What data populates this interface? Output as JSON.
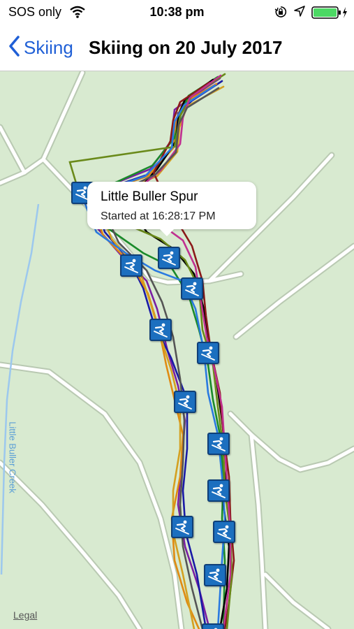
{
  "status_bar": {
    "carrier": "SOS only",
    "time": "10:38 pm",
    "icons": [
      "wifi-icon",
      "orientation-lock-icon",
      "location-arrow-icon",
      "battery-charging-icon"
    ],
    "battery_color": "#4cd964"
  },
  "nav": {
    "back_label": "Skiing",
    "title": "Skiing on 20 July 2017",
    "accent_color": "#1f5fd6"
  },
  "map": {
    "callout": {
      "title": "Little Buller Spur",
      "subtitle": "Started at 16:28:17 PM"
    },
    "creek_label": "Little Buller Creek",
    "legal_label": "Legal",
    "marker_icon": "skier-icon",
    "marker_color": "#1c6fbf",
    "track_colors": [
      "#7a1fa2",
      "#1a1aa6",
      "#e08a12",
      "#1a8a2a",
      "#000000",
      "#8b1a1a",
      "#6a8a1a",
      "#d4a020",
      "#2a7ae0",
      "#c03090",
      "#555555"
    ]
  }
}
